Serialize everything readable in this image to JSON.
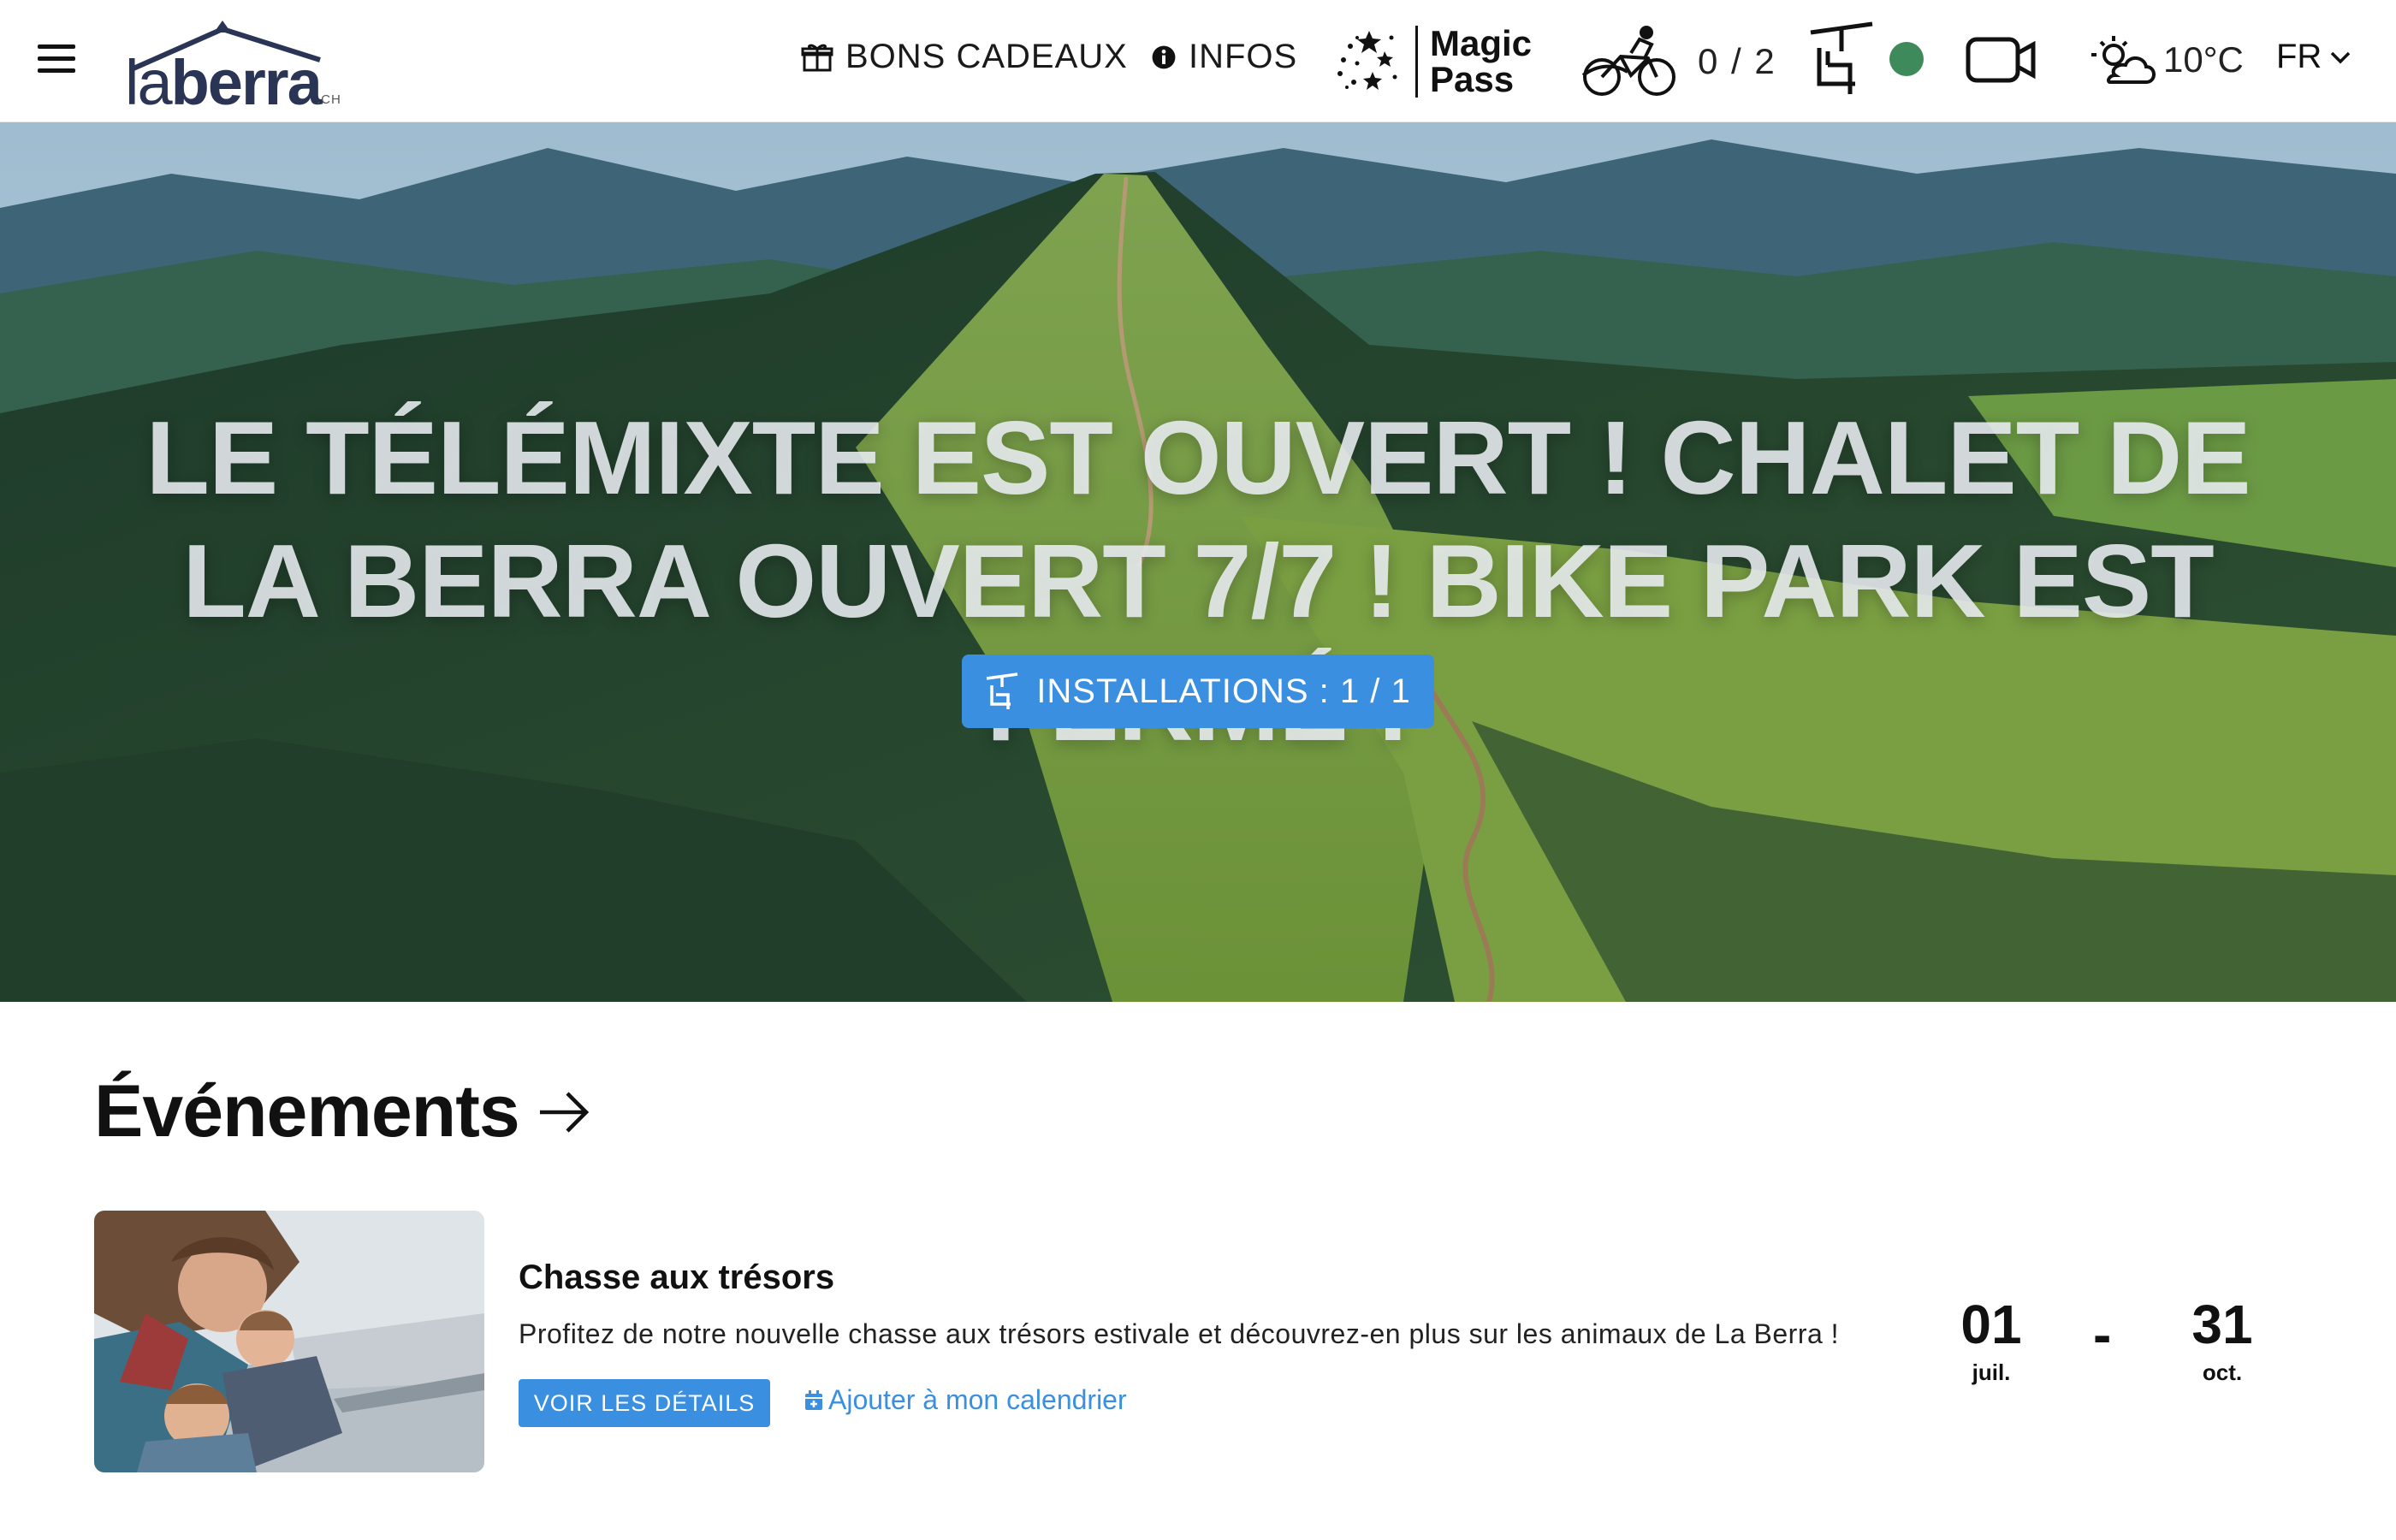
{
  "header": {
    "logo": {
      "la": "la",
      "berra": "berra",
      "suffix": ".CH"
    },
    "nav": {
      "gift_label": "BONS CADEAUX",
      "infos_label": "INFOS",
      "magic_pass": [
        "Magic",
        "Pass"
      ],
      "bike_count": "0 / 2",
      "lift_status_color": "#3e8a5a",
      "temperature": "10°C",
      "language": "FR"
    }
  },
  "hero": {
    "title": "LE TÉLÉMIXTE EST OUVERT ! CHALET DE LA BERRA OUVERT 7/7 ! BIKE PARK EST FERMÉ !",
    "installations_button": "INSTALLATIONS : 1 / 1"
  },
  "events": {
    "heading": "Événements",
    "items": [
      {
        "title": "Chasse aux trésors",
        "description": "Profitez de notre nouvelle chasse aux trésors estivale et découvrez-en plus sur les animaux de La Berra !",
        "details_button": "VOIR LES DÉTAILS",
        "calendar_link": "Ajouter à mon calendrier",
        "start_day": "01",
        "start_month": "juil.",
        "separator": "-",
        "end_day": "31",
        "end_month": "oct."
      }
    ]
  },
  "colors": {
    "accent": "#3a8fe0",
    "status_green": "#3e8a5a",
    "logo": "#2a3454"
  },
  "icons": [
    "menu-icon",
    "gift-icon",
    "info-icon",
    "magic-pass-stars-icon",
    "mountain-bike-icon",
    "chairlift-icon",
    "webcam-icon",
    "weather-cloud-sun-icon",
    "chevron-down-icon",
    "arrow-right-icon",
    "calendar-plus-icon"
  ]
}
